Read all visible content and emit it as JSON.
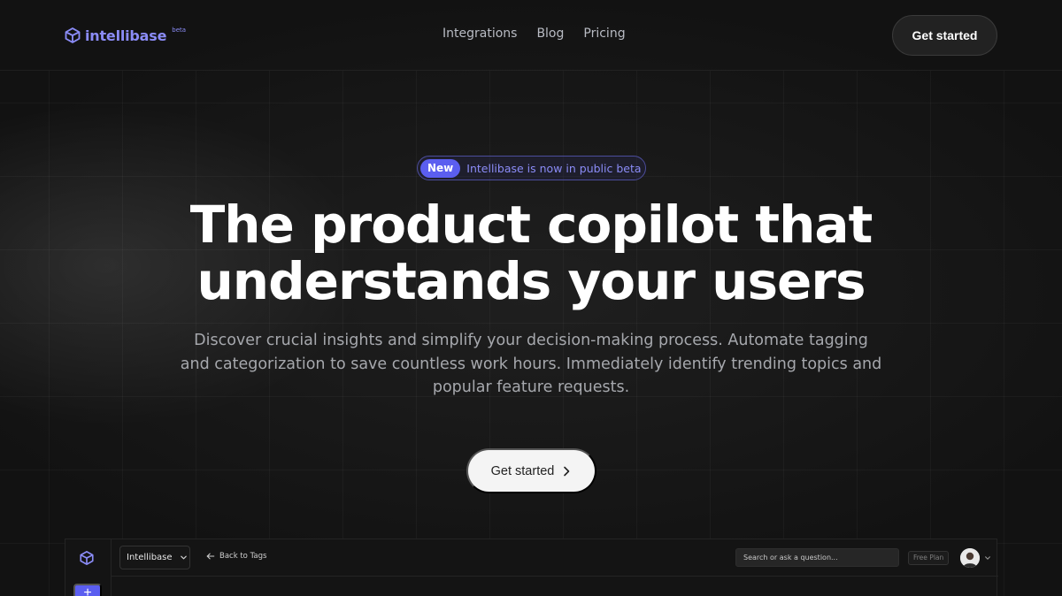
{
  "brand": {
    "name": "intellibase",
    "tag": "beta",
    "accent": "#8b8cf7",
    "primary": "#5b5ef0"
  },
  "nav": {
    "items": [
      {
        "label": "Integrations"
      },
      {
        "label": "Blog"
      },
      {
        "label": "Pricing"
      }
    ],
    "cta_label": "Get started"
  },
  "announcement": {
    "badge": "New",
    "text": "Intellibase is now in public beta",
    "icon": "arrow-right-icon"
  },
  "hero": {
    "headline_line1": "The product copilot that",
    "headline_line2": "understands your users",
    "subtitle": "Discover crucial insights and simplify your decision-making process. Automate tagging and categorization to save countless work hours. Immediately identify trending topics and popular feature requests.",
    "cta_label": "Get started",
    "cta_icon": "chevron-right-icon"
  },
  "preview": {
    "workspace": "Intellibase",
    "back_label": "Back to Tags",
    "search_placeholder": "Search or ask a question...",
    "plan_label": "Free Plan",
    "add_label": "+"
  }
}
